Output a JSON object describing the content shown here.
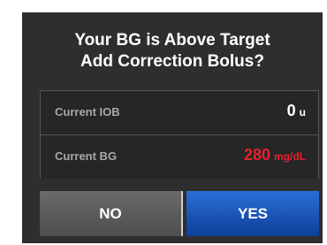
{
  "dialog": {
    "title_line1": "Your BG is Above Target",
    "title_line2": "Add Correction Bolus?"
  },
  "info": {
    "rows": [
      {
        "label": "Current IOB",
        "value": "0",
        "unit": "u",
        "color": "#ffffff"
      },
      {
        "label": "Current BG",
        "value": "280",
        "unit": "mg/dL",
        "color": "#e8202a"
      }
    ]
  },
  "buttons": {
    "no_label": "NO",
    "yes_label": "YES"
  }
}
